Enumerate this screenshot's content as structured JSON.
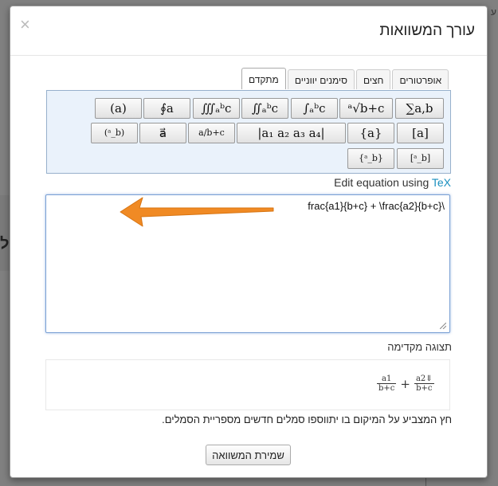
{
  "background": {
    "corner_text": "ע",
    "left_char": "ל"
  },
  "dialog": {
    "title": "עורך המשוואות",
    "close_glyph": "×"
  },
  "tabs": [
    {
      "label": "מתקדם",
      "active": true
    },
    {
      "label": "סימנים יווניים",
      "active": false
    },
    {
      "label": "חצים",
      "active": false
    },
    {
      "label": "אופרטורים",
      "active": false
    }
  ],
  "palette": {
    "row1": [
      "(a)",
      "∮a",
      "∭ₐᵇc",
      "∬ₐᵇc",
      "∫ₐᵇc",
      "ᵃ√b+c",
      "∑a,b"
    ],
    "row2": [
      "(ᵃ_b)",
      "a⃗",
      "a/b+c",
      "|a₁  a₂ a₃  a₄|",
      "{a}",
      "[a]"
    ],
    "row3": [
      "{ᵃ_b}",
      "[ᵃ_b]"
    ]
  },
  "edit_tex": {
    "prefix": "Edit equation using ",
    "link": "TeX"
  },
  "tex_input": {
    "value": "\\frac{a1}{b+c} + \\frac{a2}{b+c}"
  },
  "preview": {
    "label": "תצוגה מקדימה",
    "frac1_num": "a1",
    "frac1_den": "b+c",
    "plus": "+",
    "frac2_num": "a2⇓",
    "frac2_den": "b+c"
  },
  "hint": "חץ המצביע על המיקום בו יתווספו סמלים חדשים מספריית הסמלים.",
  "save_button": "שמירת המשוואה",
  "colors": {
    "arrow": "#f08a24",
    "link": "#1a8fbf",
    "palette_bg": "#eaf2fb"
  }
}
